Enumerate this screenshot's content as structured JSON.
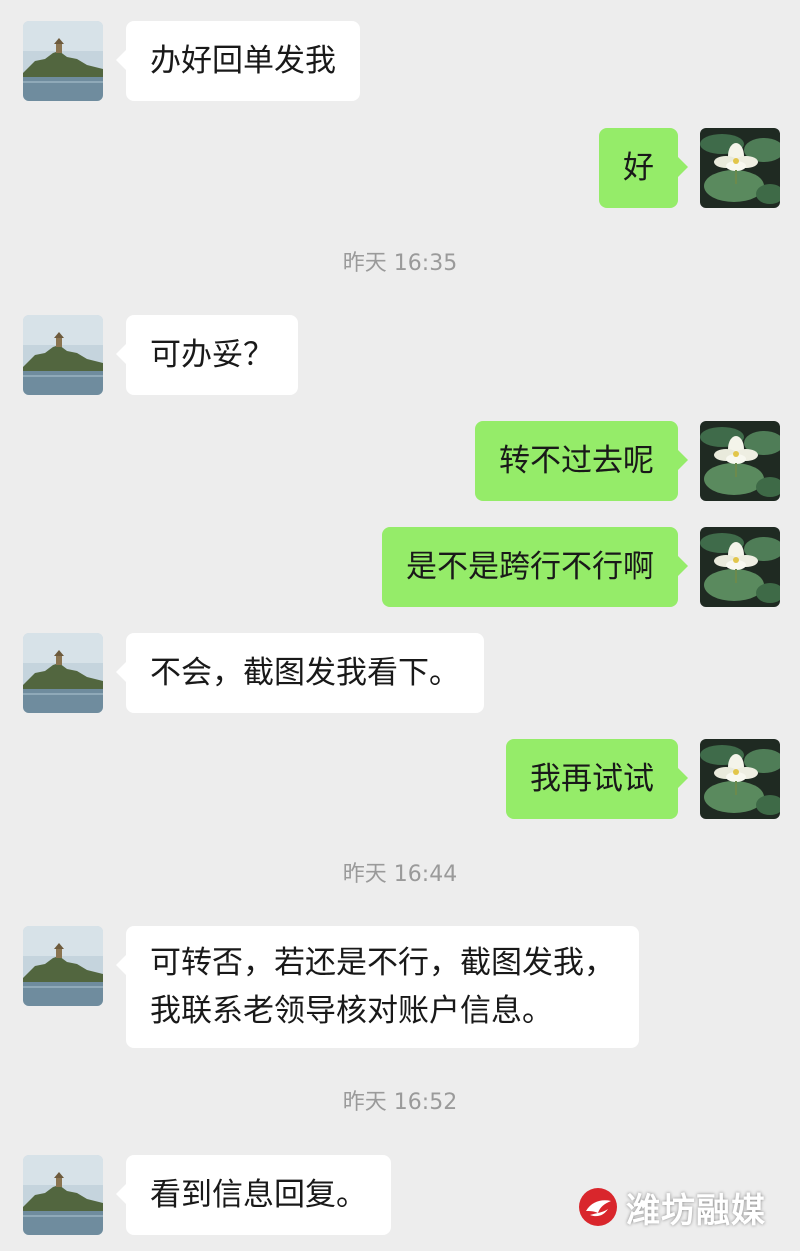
{
  "messages": [
    {
      "side": "in",
      "text": "办好回单发我"
    },
    {
      "side": "out",
      "text": "好"
    },
    {
      "side": "in",
      "text": "可办妥？"
    },
    {
      "side": "out",
      "text": "转不过去呢"
    },
    {
      "side": "out",
      "text": "是不是跨行不行啊"
    },
    {
      "side": "in",
      "text": "不会，截图发我看下。"
    },
    {
      "side": "out",
      "text": "我再试试"
    },
    {
      "side": "in",
      "lines": [
        "可转否，若还是不行，截图发我，",
        "我联系老领导核对账户信息。"
      ]
    },
    {
      "side": "in",
      "text": "看到信息回复。"
    }
  ],
  "timestamps": [
    "昨天 16:35",
    "昨天 16:44",
    "昨天 16:52"
  ],
  "watermark": {
    "text": "潍坊融媒",
    "logo": "red-wing-logo"
  },
  "colors": {
    "background": "#ededed",
    "incoming_bubble": "#ffffff",
    "outgoing_bubble": "#95ec69",
    "timestamp_text": "#9a9a9a",
    "message_text": "#191919"
  },
  "avatars": {
    "contact": "palace-on-hill-landscape",
    "self": "white-lotus-flower"
  }
}
